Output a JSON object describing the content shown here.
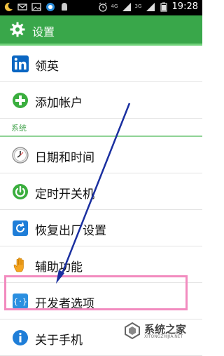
{
  "status_bar": {
    "time": "19:28",
    "icons": [
      "moon-icon",
      "mail-icon",
      "image-icon",
      "browser-icon",
      "android-icon",
      "alarm-icon",
      "signal-4g-icon",
      "signal-3g-icon",
      "battery-icon"
    ],
    "signal_labels": [
      "4G",
      "3G"
    ]
  },
  "title_bar": {
    "title": "设置",
    "icon": "gear-icon",
    "color": "#39a74a"
  },
  "settings_list": {
    "items_top": [
      {
        "label": "领英",
        "icon": "linkedin-icon"
      },
      {
        "label": "添加帐户",
        "icon": "add-icon"
      }
    ],
    "section_label": "系统",
    "items_system": [
      {
        "label": "日期和时间",
        "icon": "clock-icon"
      },
      {
        "label": "定时开关机",
        "icon": "power-icon"
      },
      {
        "label": "恢复出厂设置",
        "icon": "restore-icon"
      },
      {
        "label": "辅助功能",
        "icon": "hand-icon"
      },
      {
        "label": "开发者选项",
        "icon": "developer-icon"
      },
      {
        "label": "关于手机",
        "icon": "info-icon"
      }
    ]
  },
  "annotation": {
    "highlight_color": "#f28bbf",
    "arrow_color": "#1a2fa0"
  },
  "watermark": {
    "text": "系统之家",
    "url": "XITONGZHIJIA.NET"
  }
}
